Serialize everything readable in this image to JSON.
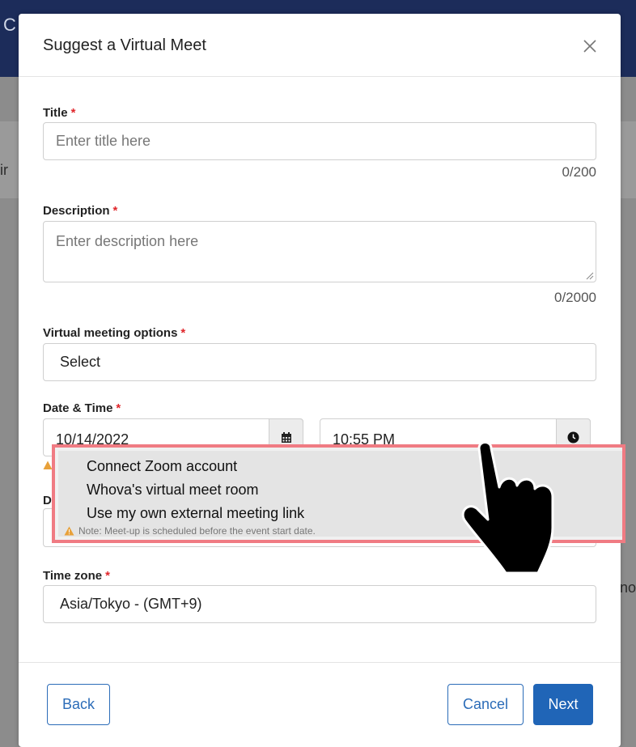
{
  "background": {
    "header_letter": "C",
    "left_fragment": "ir",
    "right_fragment": "no"
  },
  "modal": {
    "title": "Suggest a Virtual Meet",
    "close_icon": "close-icon"
  },
  "form": {
    "title": {
      "label": "Title",
      "required_mark": "*",
      "placeholder": "Enter title here",
      "counter": "0/200"
    },
    "description": {
      "label": "Description",
      "required_mark": "*",
      "placeholder": "Enter description here",
      "counter": "0/2000"
    },
    "meeting_options": {
      "label": "Virtual meeting options",
      "required_mark": "*",
      "value": "Select"
    },
    "datetime": {
      "label": "Date & Time",
      "required_mark": "*",
      "date": "10/14/2022",
      "time": "10:55 PM",
      "calendar_icon": "calendar-icon",
      "clock_icon": "clock-icon"
    },
    "duration_label_fragment": "D",
    "timezone": {
      "label": "Time zone",
      "required_mark": "*",
      "value": "Asia/Tokyo - (GMT+9)"
    }
  },
  "dropdown": {
    "options": [
      "Connect Zoom account",
      "Whova's virtual meet room",
      "Use my own external meeting link"
    ],
    "note": "Note: Meet-up is scheduled before the event start date.",
    "highlight_color": "#f07b83"
  },
  "footer": {
    "back": "Back",
    "cancel": "Cancel",
    "next": "Next"
  },
  "colors": {
    "primary": "#2065b7",
    "required": "#e0262b",
    "warning": "#e8a13a"
  }
}
